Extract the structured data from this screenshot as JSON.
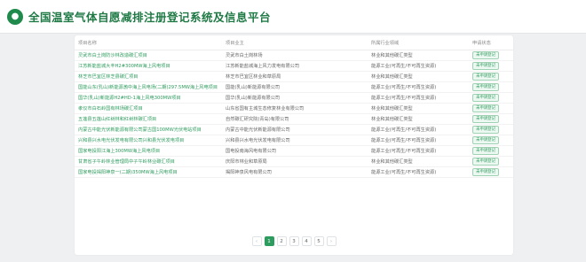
{
  "header": {
    "logo_icon": "leaf-globe-icon",
    "title": "全国温室气体自愿减排注册登记系统及信息平台"
  },
  "table": {
    "headers": [
      "项目名称",
      "项目业主",
      "所属行业领域",
      "申请状态"
    ],
    "rows": [
      [
        "灵武市白土岗防沙林改造碳汇项目",
        "灵武市白土岗林场",
        "林业和其他碳汇类型",
        "未申请登记"
      ],
      [
        "江苏新能盐城大丰H2#300MW海上风电项目",
        "江苏新能盐城海上风力发电有限公司",
        "能源工业(可再生/不可再生资源)",
        "未申请登记"
      ],
      [
        "林芝市巴宜区林芝县碳汇项目",
        "林芝市巴宜区林业和草原局",
        "林业和其他碳汇类型",
        "未申请登记"
      ],
      [
        "国能山东(乳山)新能源渤中海上风电场(二期)297.5MW海上风电项目",
        "国能(乳山)新能源有限公司",
        "能源工业(可再生/不可再生资源)",
        "未申请登记"
      ],
      [
        "国华(乳山)新能源H2#HD-1海上风电300MW项目",
        "国华(乳山)新能源有限公司",
        "能源工业(可再生/不可再生资源)",
        "未申请登记"
      ],
      [
        "孝仪市白石岭国有林场碳汇项目",
        "山东省国有主城生态修复林业有限公司",
        "林业和其他碳汇类型",
        "未申请登记"
      ],
      [
        "五莲县五莲山红树林和红树林碳汇项目",
        "自然碳汇研究院(青岛)有限公司",
        "林业和其他碳汇类型",
        "未申请登记"
      ],
      [
        "内蒙古中能光伏新能源有限公司蒙古国100MW光伏电站项目",
        "内蒙古中能光伏新能源有限公司",
        "能源工业(可再生/不可再生资源)",
        "未申请登记"
      ],
      [
        "兴和县兴水电光伏发电有限公司兴和县光伏发电项目",
        "兴和县兴水电光伏发电有限公司",
        "能源工业(可再生/不可再生资源)",
        "未申请登记"
      ],
      [
        "国家电投阳江海上300MW海上风电项目",
        "国电投南海风电有限公司",
        "能源工业(可再生/不可再生资源)",
        "未申请登记"
      ],
      [
        "甘肃省子午岭林业管理局中子午岭林业碳汇项目",
        "庆阳市林业和草原局",
        "林业和其他碳汇类型",
        "未申请登记"
      ],
      [
        "国家电投揭阳神泉一(二期)350MW海上风电项目",
        "揭阳神泉风电有限公司",
        "能源工业(可再生/不可再生资源)",
        "未申请登记"
      ]
    ]
  },
  "pagination": {
    "prev_icon": "chevron-left-icon",
    "pages": [
      "1",
      "2",
      "3",
      "4",
      "5"
    ],
    "active": "1",
    "next_icon": "chevron-right-icon",
    "prev": "‹",
    "next": "›"
  }
}
